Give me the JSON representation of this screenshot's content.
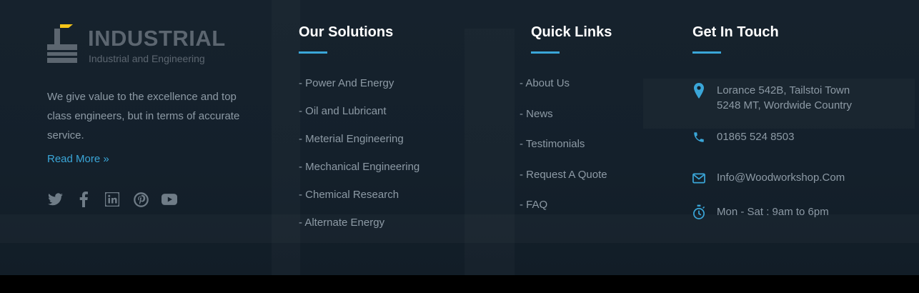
{
  "logo": {
    "title": "INDUSTRIAL",
    "subtitle": "Industrial and Engineering"
  },
  "about": {
    "text": "We give value to the excellence and top class engineers, but in terms of accurate service.",
    "read_more": "Read More »"
  },
  "socials": [
    "twitter-icon",
    "facebook-icon",
    "linkedin-icon",
    "pinterest-icon",
    "youtube-icon"
  ],
  "solutions": {
    "heading": "Our Solutions",
    "items": [
      "- Power And Energy",
      "- Oil and Lubricant",
      "- Meterial Engineering",
      "- Mechanical Engineering",
      "- Chemical Research",
      "- Alternate Energy"
    ]
  },
  "quick_links": {
    "heading": "Quick Links",
    "items": [
      "-  About Us",
      "-  News",
      "-  Testimonials",
      "-  Request A Quote",
      "-  FAQ"
    ]
  },
  "contact": {
    "heading": "Get In Touch",
    "address_line1": "Lorance 542B, Tailstoi Town",
    "address_line2": "5248 MT, Wordwide Country",
    "phone": "01865 524 8503",
    "email": "Info@Woodworkshop.Com",
    "hours": "Mon - Sat : 9am to 6pm"
  },
  "colors": {
    "accent": "#3aa6d8",
    "heading": "#ffffff",
    "text": "#8d9aa5",
    "logo_accent": "#f5c518"
  }
}
